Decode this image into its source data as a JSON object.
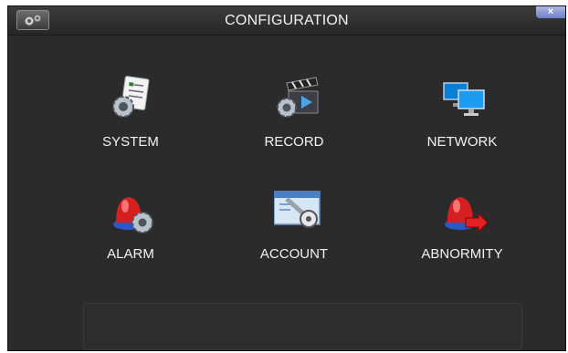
{
  "window": {
    "title": "CONFIGURATION",
    "app_icon": "gears-icon",
    "close_label": "×"
  },
  "menu": {
    "items": [
      {
        "label": "SYSTEM",
        "icon": "system-settings-icon"
      },
      {
        "label": "RECORD",
        "icon": "record-clapperboard-icon"
      },
      {
        "label": "NETWORK",
        "icon": "network-monitors-icon"
      },
      {
        "label": "ALARM",
        "icon": "alarm-siren-icon"
      },
      {
        "label": "ACCOUNT",
        "icon": "account-key-icon"
      },
      {
        "label": "ABNORMITY",
        "icon": "abnormity-siren-icon"
      }
    ]
  },
  "colors": {
    "background": "#2b2b2b",
    "text": "#f2f2f2",
    "close_button": "#8f9ad8",
    "siren_red": "#d62020"
  }
}
